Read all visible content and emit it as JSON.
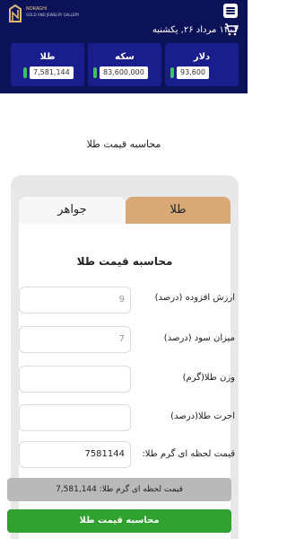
{
  "header": {
    "logo_text_line1": "NORAGHI",
    "logo_text_line2": "GOLD AND JEWELRY GALLERY",
    "date": "۱۴۰۴ مرداد ۲۶, یکشنبه",
    "menu_icon": "hamburger-menu-icon",
    "cart_icon": "shopping-cart-icon"
  },
  "prices": [
    {
      "title": "دلار",
      "value": "93,600",
      "indicator_color": "#3ec160"
    },
    {
      "title": "سکه",
      "value": "83,600,000",
      "indicator_color": "#3ec160"
    },
    {
      "title": "طلا",
      "value": "7,581,144",
      "indicator_color": "#3ec160"
    }
  ],
  "page_title": "محاسبه قیمت طلا",
  "tabs": [
    {
      "label": "طلا",
      "active": true
    },
    {
      "label": "جواهر",
      "active": false
    }
  ],
  "form": {
    "title": "محاسبه قیمت طلا",
    "fields": [
      {
        "label": "ارزش افزوده (درصد)",
        "value": "9"
      },
      {
        "label": "میزان سود (درصد)",
        "value": "7"
      },
      {
        "label": "وزن طلا(گرم)",
        "value": ""
      },
      {
        "label": "اجرت طلا(درصد)",
        "value": ""
      },
      {
        "label": "قیمت لحظه ای گرم طلا:",
        "value": "7581144"
      }
    ],
    "result_text": "قیمت لحظه ای گرم طلا: 7,581,144",
    "submit_label": "محاسبه قیمت طلا"
  },
  "colors": {
    "header_bg": "#0c1257",
    "card_bg": "#1a1d8c",
    "active_tab": "#d8a876",
    "button": "#2ea12e"
  }
}
